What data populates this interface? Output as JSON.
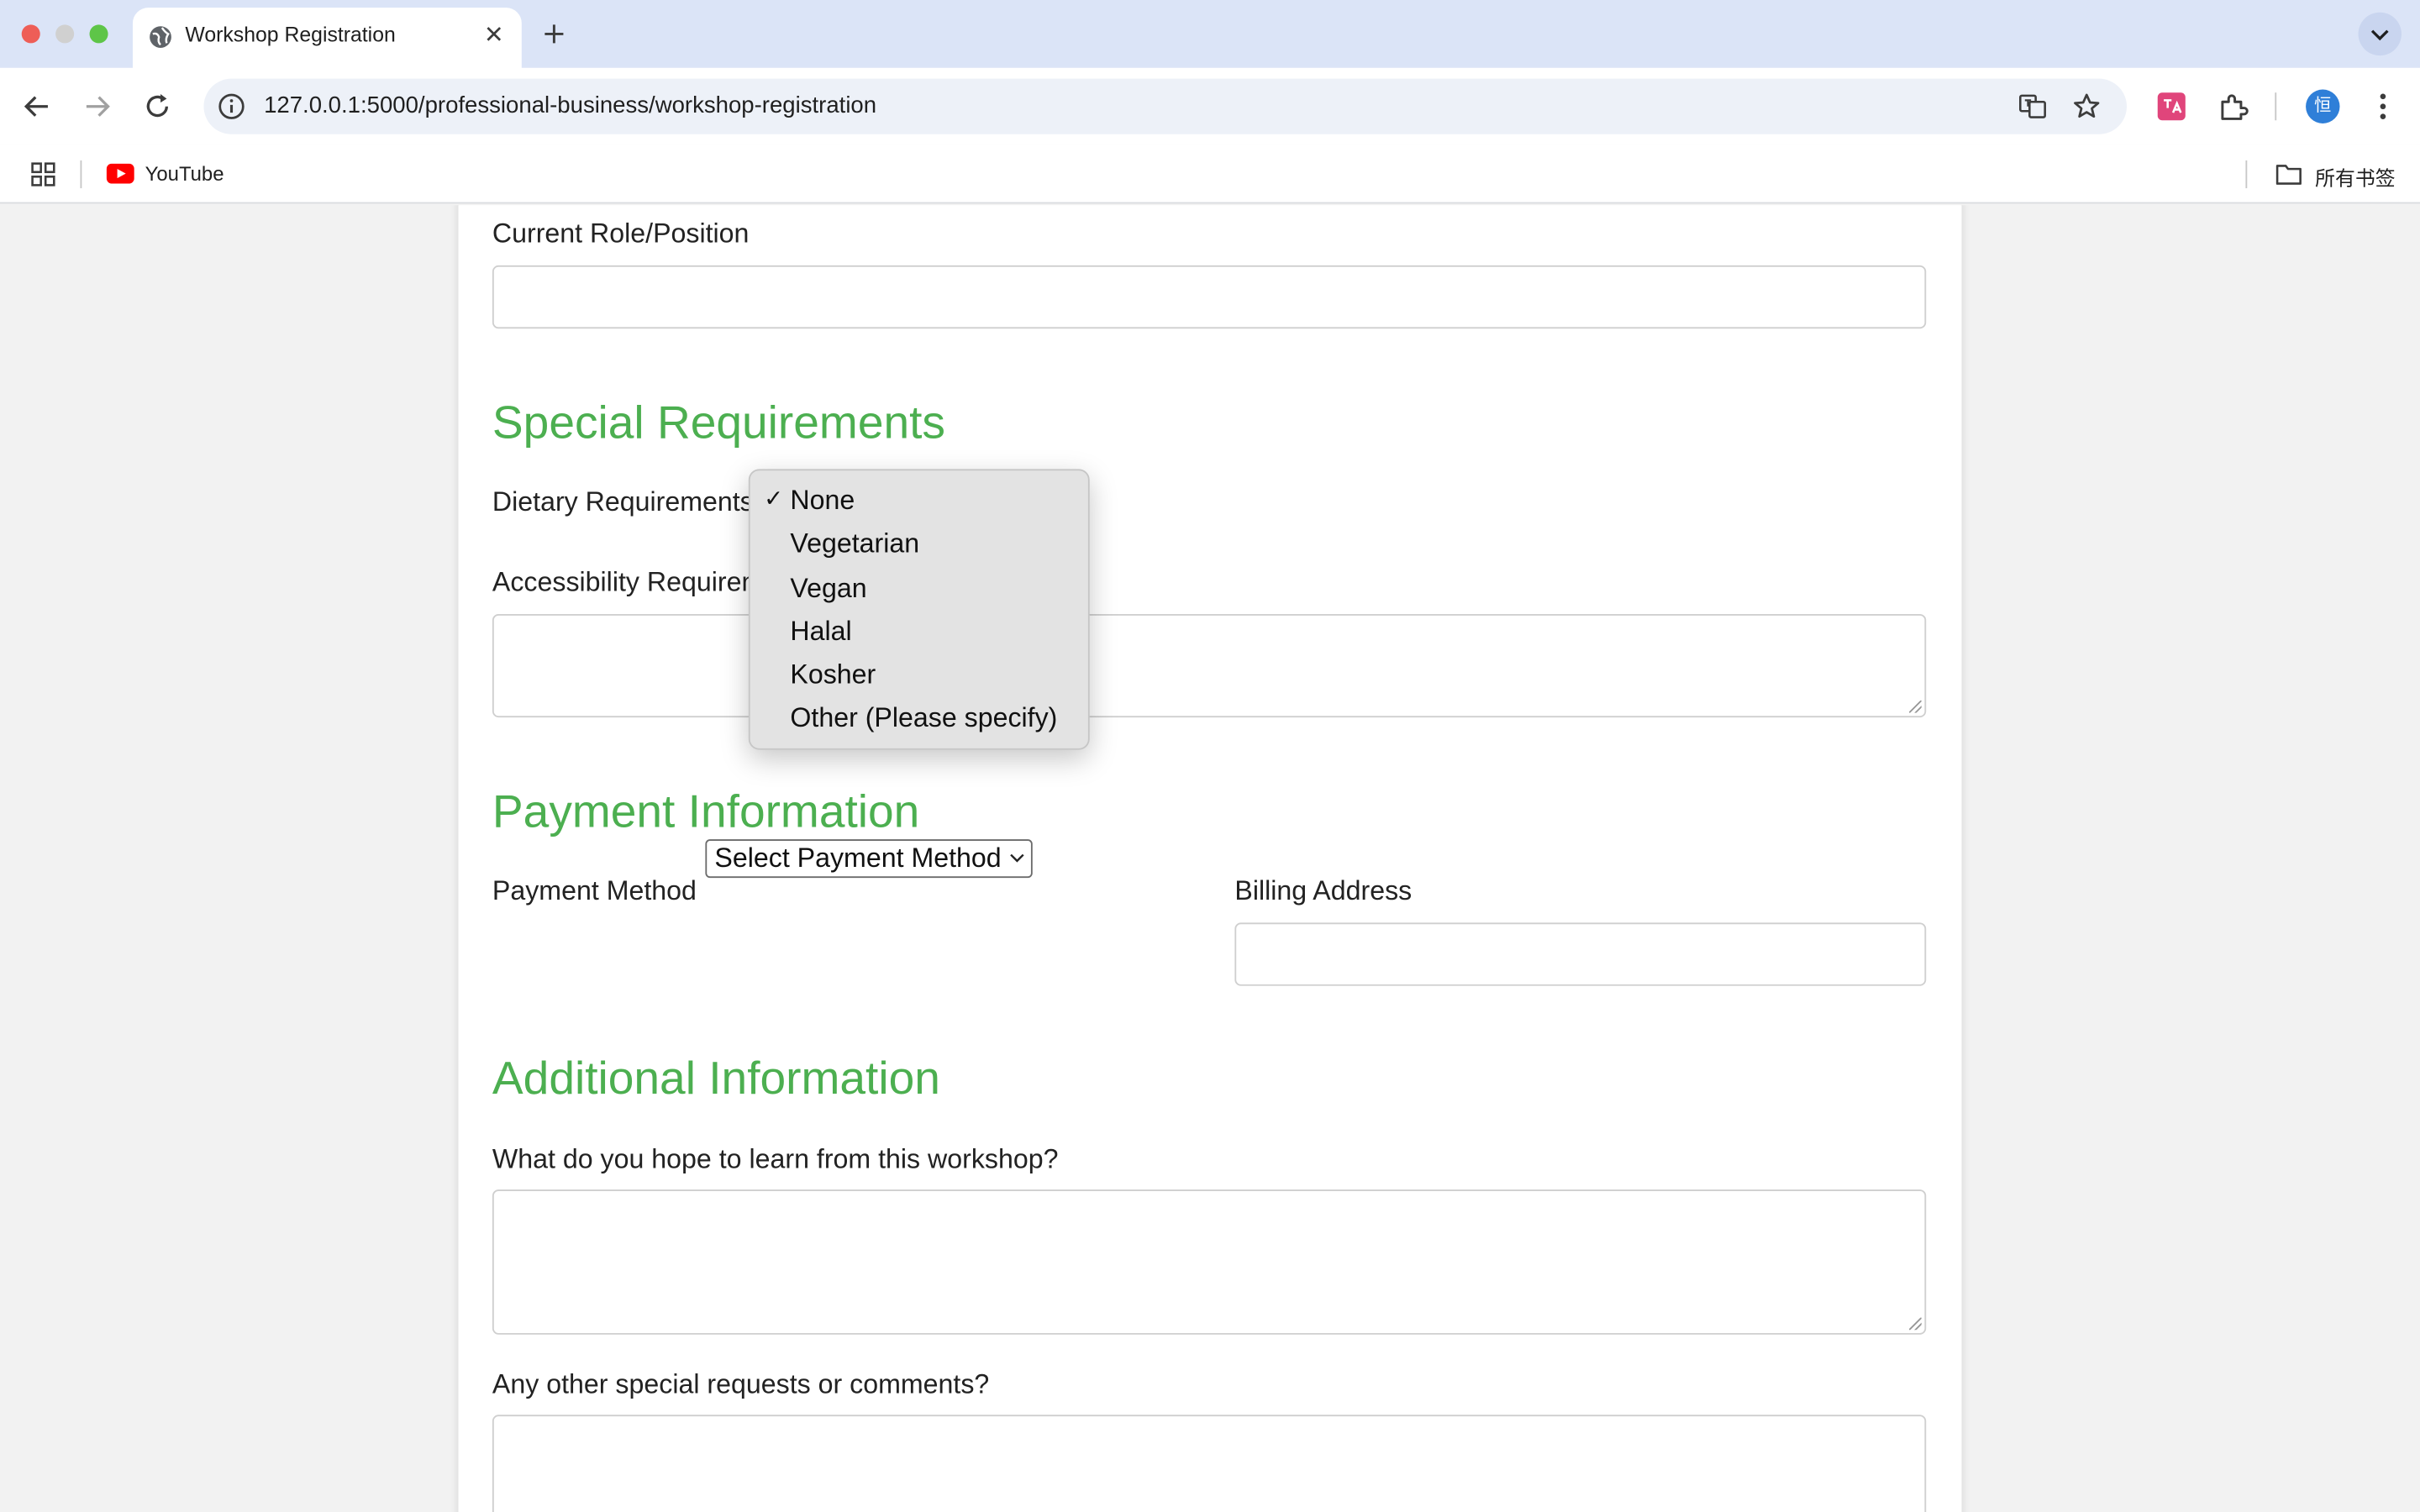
{
  "browser": {
    "tab_title": "Workshop Registration",
    "url": "127.0.0.1:5000/professional-business/workshop-registration",
    "bookmarks": [
      {
        "label": "YouTube",
        "icon": "youtube-icon"
      }
    ],
    "all_bookmarks_label": "所有书签",
    "profile_initial": "恒"
  },
  "form": {
    "current_role_label": "Current Role/Position",
    "current_role_value": "",
    "special_requirements_title": "Special Requirements",
    "dietary_label": "Dietary Requirements",
    "dietary_options": [
      {
        "label": "None",
        "selected": true
      },
      {
        "label": "Vegetarian",
        "selected": false
      },
      {
        "label": "Vegan",
        "selected": false
      },
      {
        "label": "Halal",
        "selected": false
      },
      {
        "label": "Kosher",
        "selected": false
      },
      {
        "label": "Other (Please specify)",
        "selected": false
      }
    ],
    "accessibility_label": "Accessibility Requirements",
    "accessibility_value": "",
    "payment_title": "Payment Information",
    "payment_method_label": "Payment Method",
    "payment_method_selected": "Select Payment Method",
    "billing_address_label": "Billing Address",
    "billing_address_value": "",
    "additional_title": "Additional Information",
    "learn_label": "What do you hope to learn from this workshop?",
    "learn_value": "",
    "comments_label": "Any other special requests or comments?",
    "comments_value": ""
  },
  "colors": {
    "section_title": "#4caf50",
    "titlebar": "#dbe4f7",
    "dropdown_bg": "#e3e3e3"
  }
}
